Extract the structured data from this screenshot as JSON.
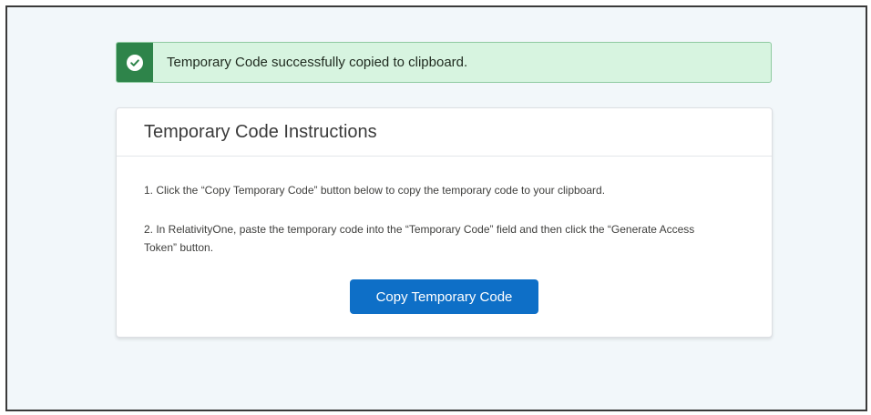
{
  "toast": {
    "message": "Temporary Code successfully copied to clipboard.",
    "icon": "success-check-icon",
    "colors": {
      "icon_bg": "#2e844a",
      "bg": "#d7f4e0",
      "border": "#8fcaa0"
    }
  },
  "card": {
    "title": "Temporary Code Instructions",
    "step1": "1. Click the “Copy Temporary Code” button below to copy the temporary code to your clipboard.",
    "step2": "2. In RelativityOne, paste the temporary code into the “Temporary Code” field and then click the “Generate Access Token” button.",
    "button_label": "Copy Temporary Code"
  },
  "colors": {
    "accent": "#0e6fc7",
    "page_bg": "#f2f7fa"
  }
}
